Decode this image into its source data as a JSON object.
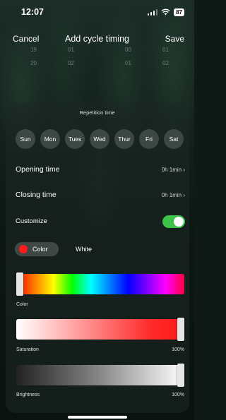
{
  "status_bar": {
    "time": "12:07",
    "battery": "87"
  },
  "nav": {
    "cancel": "Cancel",
    "title": "Add cycle timing",
    "save": "Save"
  },
  "time_picker": {
    "rows": [
      [
        "19",
        "01",
        "00",
        "01"
      ],
      [
        "20",
        "02",
        "01",
        "02"
      ]
    ]
  },
  "repetition": {
    "label": "Repetition time",
    "days": [
      "Sun",
      "Mon",
      "Tues",
      "Wed",
      "Thur",
      "Fri",
      "Sat"
    ]
  },
  "opening": {
    "label": "Opening time",
    "value": "0h 1min"
  },
  "closing": {
    "label": "Closing time",
    "value": "0h 1min"
  },
  "customize": {
    "label": "Customize",
    "enabled": true
  },
  "mode": {
    "color": "Color",
    "white": "White",
    "selected_color": "#ff1b1b"
  },
  "sliders": {
    "color": {
      "label": "Color",
      "value": 0
    },
    "saturation": {
      "label": "Saturation",
      "value_text": "100%",
      "value": 1
    },
    "brightness": {
      "label": "Brightness",
      "value_text": "100%",
      "value": 1
    }
  },
  "colors": {
    "accent_green": "#3ec44a"
  }
}
